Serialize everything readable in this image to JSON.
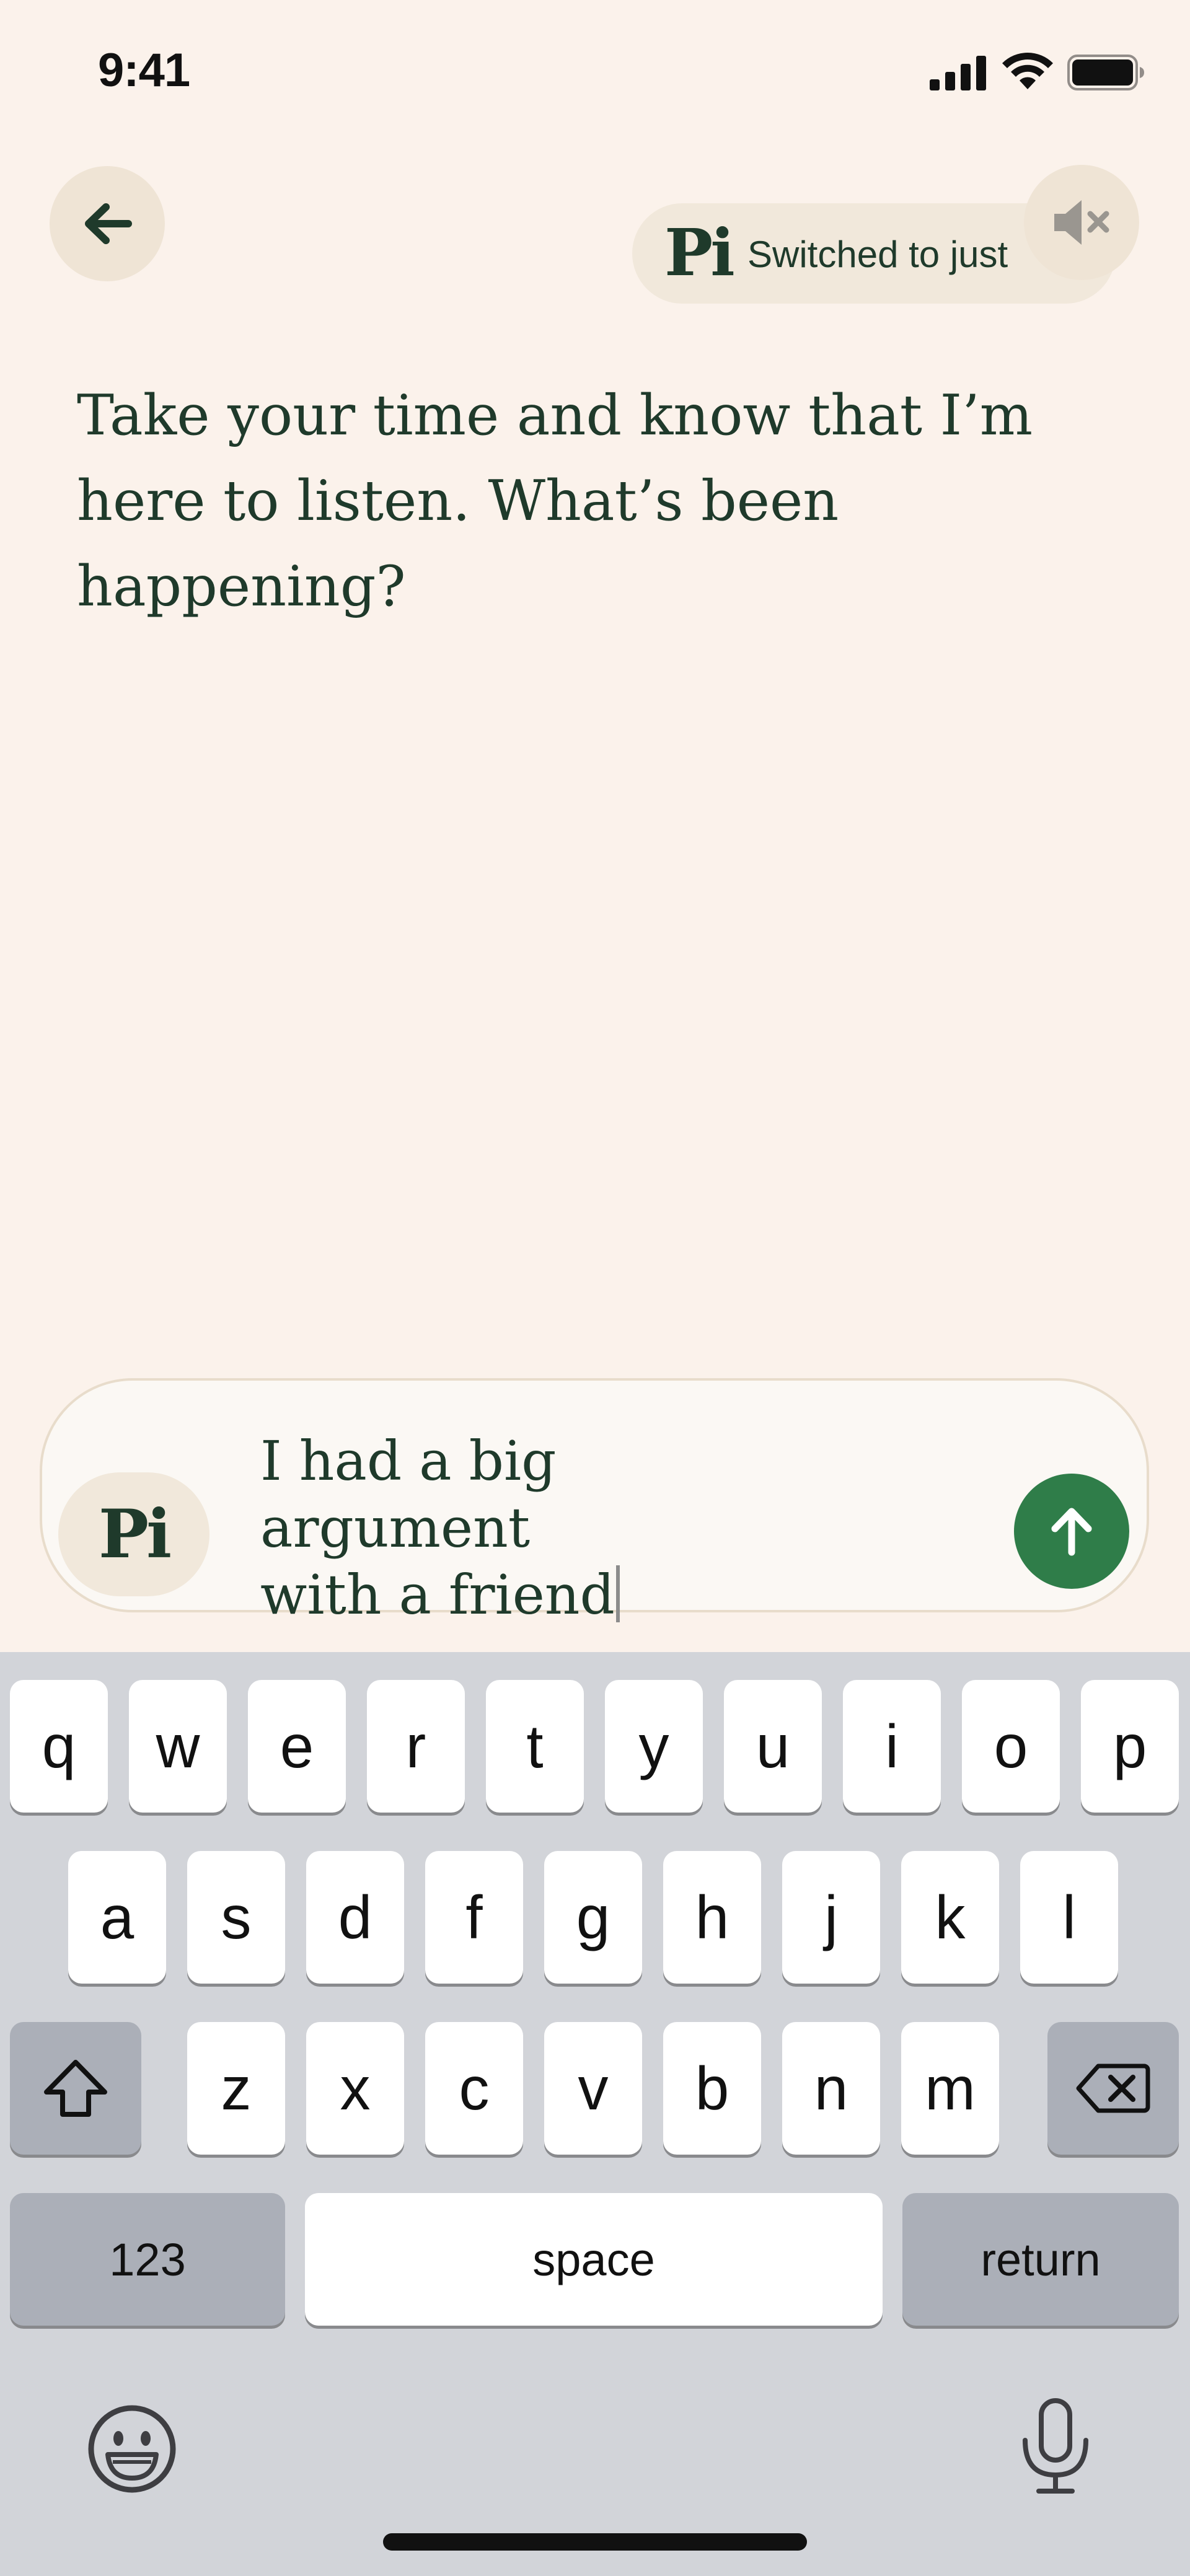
{
  "status_bar": {
    "time": "9:41"
  },
  "header": {
    "back_icon": "arrow-left-icon",
    "toast_logo": "Pi",
    "toast_text": "Switched to just",
    "mute_icon": "speaker-muted-icon"
  },
  "conversation": {
    "assistant_message": "Take your time and know that I’m here to listen. What’s been happening?"
  },
  "composer": {
    "logo": "Pi",
    "input_line_1": "I had a big argument",
    "input_line_2": "with a friend",
    "send_icon": "arrow-up-icon"
  },
  "keyboard": {
    "row1": [
      "q",
      "w",
      "e",
      "r",
      "t",
      "y",
      "u",
      "i",
      "o",
      "p"
    ],
    "row2": [
      "a",
      "s",
      "d",
      "f",
      "g",
      "h",
      "j",
      "k",
      "l"
    ],
    "row3": [
      "z",
      "x",
      "c",
      "v",
      "b",
      "n",
      "m"
    ],
    "shift_icon": "shift-icon",
    "delete_icon": "backspace-icon",
    "numbers_label": "123",
    "space_label": "space",
    "return_label": "return",
    "emoji_icon": "emoji-icon",
    "dictation_icon": "microphone-icon"
  },
  "colors": {
    "background": "#FBF2EB",
    "accent_green": "#2F7D49",
    "text_dark_green": "#1F3A2B",
    "chip_beige": "#EFE4D5",
    "keyboard_bg": "#D2D4D9",
    "key_dark": "#ABAFB8"
  }
}
